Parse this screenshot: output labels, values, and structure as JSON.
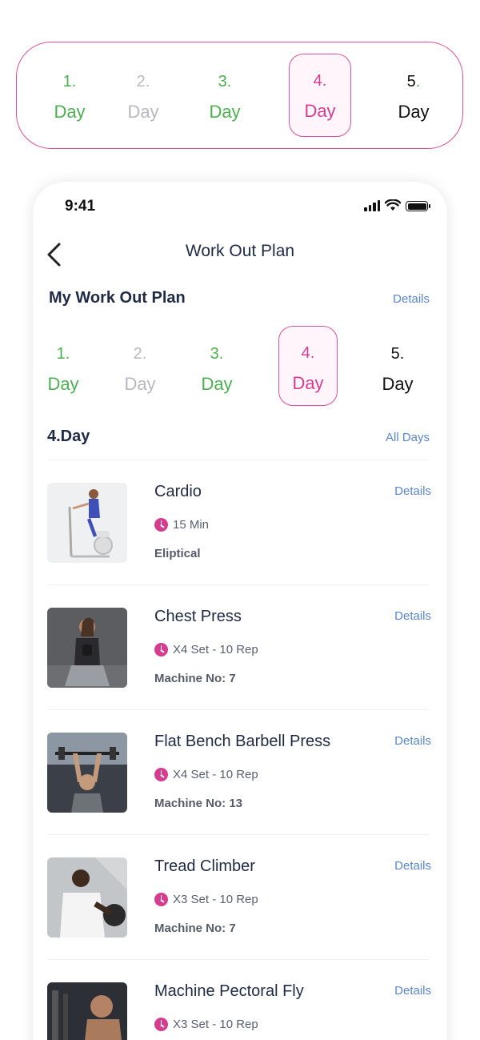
{
  "top_selector": {
    "days": [
      {
        "num": "1.",
        "label": "Day",
        "state": "done"
      },
      {
        "num": "2.",
        "label": "Day",
        "state": "skipped"
      },
      {
        "num": "3.",
        "label": "Day",
        "state": "done"
      },
      {
        "num": "4.",
        "label": "Day",
        "state": "active"
      },
      {
        "num": "5",
        "dot": ".",
        "label": "Day",
        "state": "upcoming"
      }
    ]
  },
  "phone": {
    "status_time": "9:41",
    "nav_title": "Work Out Plan",
    "plan_title": "My Work Out Plan",
    "plan_details": "Details",
    "days": [
      {
        "num": "1.",
        "label": "Day"
      },
      {
        "num": "2.",
        "label": "Day"
      },
      {
        "num": "3.",
        "label": "Day"
      },
      {
        "num": "4.",
        "label": "Day"
      },
      {
        "num": "5.",
        "label": "Day"
      }
    ],
    "current_day": "4.Day",
    "all_days": "All Days",
    "exercises": [
      {
        "name": "Cardio",
        "meta": "15 Min",
        "sub": "Eliptical",
        "details": "Details"
      },
      {
        "name": "Chest Press",
        "meta": "X4 Set - 10 Rep",
        "sub": "Machine No: 7",
        "details": "Details"
      },
      {
        "name": "Flat Bench Barbell Press",
        "meta": "X4 Set - 10 Rep",
        "sub": "Machine No: 13",
        "details": "Details"
      },
      {
        "name": "Tread Climber",
        "meta": "X3 Set - 10 Rep",
        "sub": "Machine No: 7",
        "details": "Details"
      },
      {
        "name": "Machine Pectoral Fly",
        "meta": "X3 Set - 10 Rep",
        "sub": "",
        "details": "Details"
      }
    ]
  },
  "colors": {
    "done": "#4caf50",
    "skipped": "#b8b8c0",
    "active": "#d63c8f",
    "link": "#5b86c9",
    "text": "#1f2a44"
  }
}
